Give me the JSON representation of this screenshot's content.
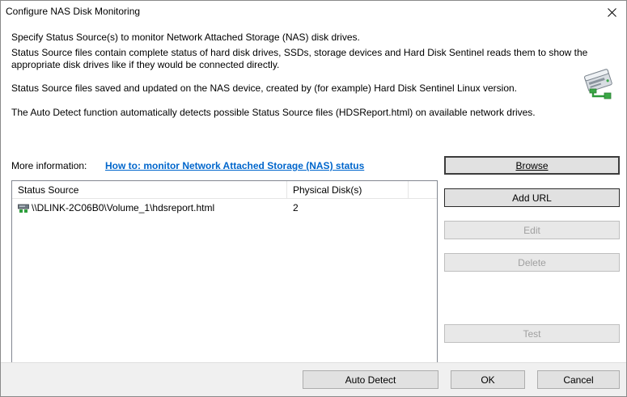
{
  "window": {
    "title": "Configure NAS Disk Monitoring"
  },
  "description": {
    "line1": "Specify Status Source(s) to monitor Network Attached Storage (NAS) disk drives.",
    "line2": "Status Source files contain complete status of hard disk drives, SSDs, storage devices and Hard Disk Sentinel reads them to show the",
    "line3": "appropriate disk drives like if they would be connected directly.",
    "line4": "Status Source files saved and updated on the NAS device, created by (for example) Hard Disk Sentinel Linux version.",
    "line5": "The Auto Detect function automatically detects possible Status Source files (HDSReport.html) on available network drives."
  },
  "more_info": {
    "label": "More information:",
    "link_text": "How to: monitor Network Attached Storage (NAS) status"
  },
  "list": {
    "columns": [
      "Status Source",
      "Physical Disk(s)"
    ],
    "rows": [
      {
        "source": "\\\\DLINK-2C06B0\\Volume_1\\hdsreport.html",
        "disks": "2",
        "icon": "nas-drive-icon"
      }
    ]
  },
  "side_buttons": {
    "browse": "Browse",
    "add_url": "Add URL",
    "edit": "Edit",
    "delete": "Delete",
    "test": "Test"
  },
  "footer_buttons": {
    "auto_detect": "Auto Detect",
    "ok": "OK",
    "cancel": "Cancel"
  },
  "colors": {
    "link": "#0066cc",
    "accent": "#0078d7",
    "footer_bg": "#f0f0f0"
  }
}
